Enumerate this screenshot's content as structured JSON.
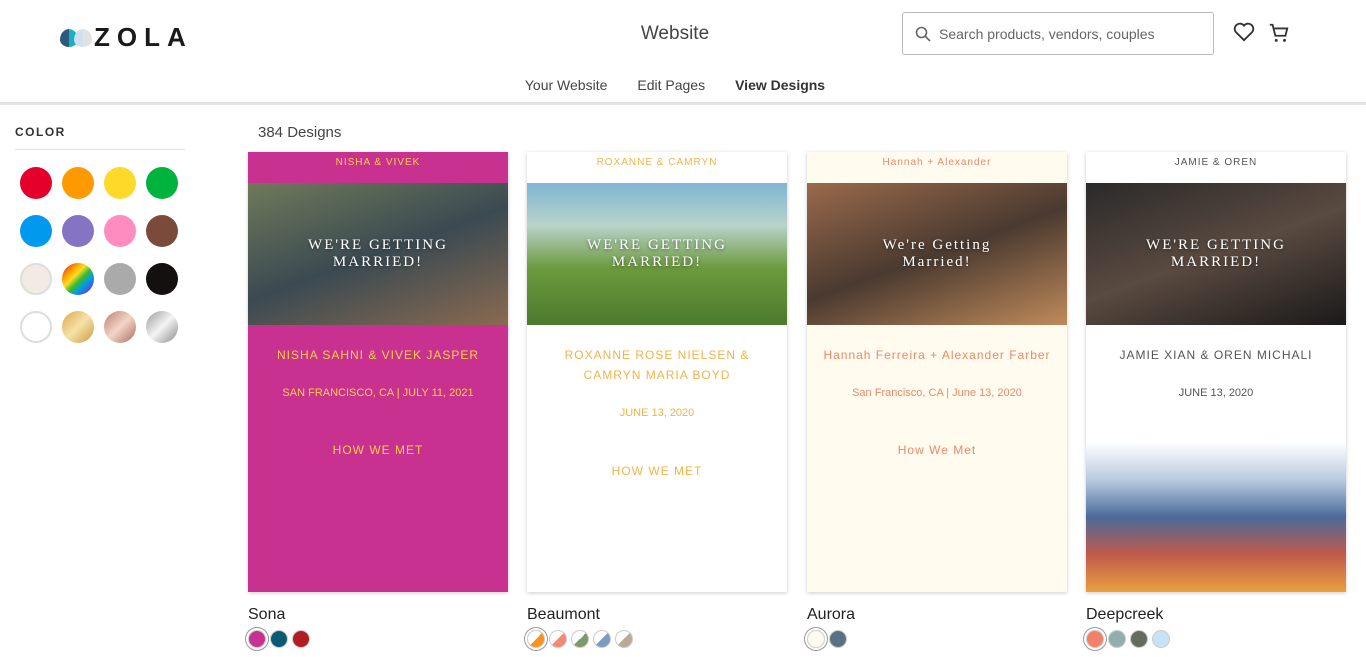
{
  "header": {
    "logo": "ZOLA",
    "title": "Website",
    "search_placeholder": "Search products, vendors, couples",
    "icons": [
      "search-icon",
      "heart-icon",
      "cart-icon"
    ]
  },
  "subnav": [
    {
      "label": "Your Website"
    },
    {
      "label": "Edit Pages"
    },
    {
      "label": "View Designs",
      "active": true
    }
  ],
  "sidebar": {
    "label": "COLOR",
    "swatches": [
      "#e4002b",
      "#ff9900",
      "#ffd92a",
      "#00b33c",
      "#0099ee",
      "#8573c4",
      "#ff8cc0",
      "#7a4b3a",
      "#f2ebe3",
      "rainbow",
      "#aaaaaa",
      "#141010",
      "#ffffff",
      "gold",
      "rose-gold",
      "silver"
    ]
  },
  "count": "384 Designs",
  "designs": [
    {
      "name": "Sona",
      "couple": "NISHA & VIVEK",
      "headline": "WE'RE GETTING MARRIED!",
      "names": "NISHA SAHNI & VIVEK JASPER",
      "place": "SAN FRANCISCO, CA  |  JULY 11, 2021",
      "section": "HOW WE MET",
      "colors": [
        "#c8318f",
        "#0b5a73",
        "#b01d23"
      ]
    },
    {
      "name": "Beaumont",
      "couple": "ROXANNE & CAMRYN",
      "headline": "WE'RE GETTING MARRIED!",
      "names": "ROXANNE ROSE NIELSEN & CAMRYN MARIA BOYD",
      "place": "JUNE 13, 2020",
      "section": "HOW WE MET",
      "colors": [
        "#f7941d",
        "#f08a75",
        "#7c9a6a",
        "#7a9cc0",
        "#bba995"
      ]
    },
    {
      "name": "Aurora",
      "couple": "Hannah + Alexander",
      "headline": "We're Getting Married!",
      "names": "Hannah Ferreira + Alexander Farber",
      "place": "San Francisco, CA  |  June 13, 2020",
      "section": "How We Met",
      "colors": [
        "#fdfaf0",
        "#5a7184"
      ]
    },
    {
      "name": "Deepcreek",
      "couple": "JAMIE & OREN",
      "headline": "WE'RE GETTING MARRIED!",
      "names": "JAMIE XIAN & OREN MICHALI",
      "place": "JUNE 13, 2020",
      "section": "",
      "colors": [
        "#f4806a",
        "#92b0ab",
        "#666c5c",
        "#c6e2f5"
      ]
    }
  ]
}
